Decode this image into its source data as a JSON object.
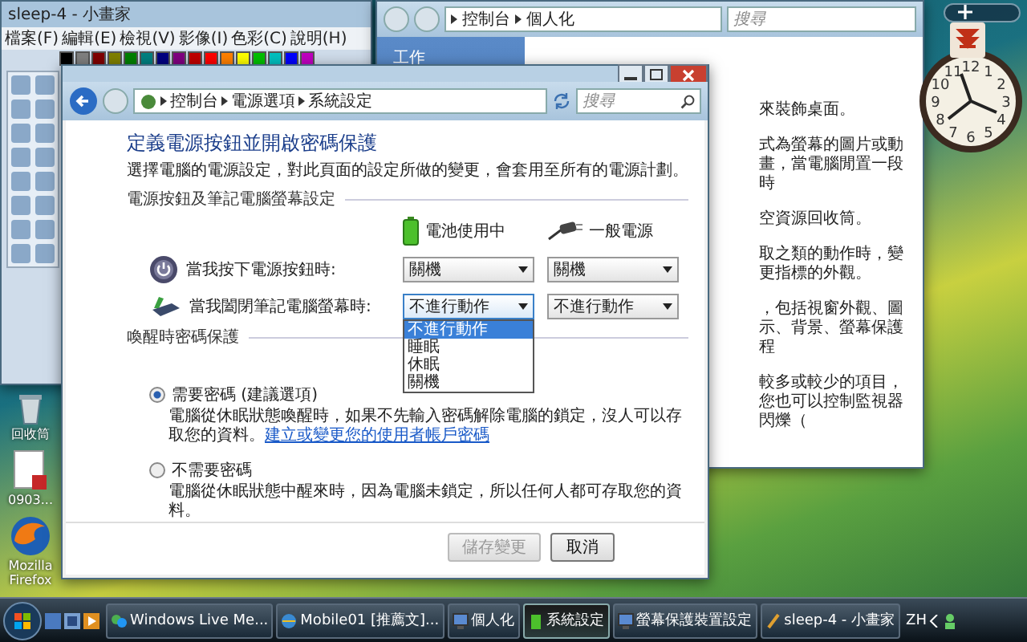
{
  "paint_window": {
    "title": "sleep-4 - 小畫家",
    "menus": [
      "檔案(F)",
      "編輯(E)",
      "檢視(V)",
      "影像(I)",
      "色彩(C)",
      "說明(H)"
    ]
  },
  "personalize_window": {
    "breadcrumb": [
      "控制台",
      "個人化"
    ],
    "search": {
      "placeholder": "搜尋"
    },
    "sidebar_title": "工作",
    "descriptions": [
      "來裝飾桌面。",
      "式為螢幕的圖片或動畫，當電腦閒置一段時",
      "空資源回收筒。",
      "取之類的動作時，變更指標的外觀。",
      "，包括視窗外觀、圖示、背景、螢幕保護程",
      "較多或較少的項目，您也可以控制監視器閃爍（"
    ]
  },
  "dialog": {
    "breadcrumb": [
      "控制台",
      "電源選項",
      "系統設定"
    ],
    "search": {
      "placeholder": "搜尋"
    },
    "title": "定義電源按鈕並開啟密碼保護",
    "description": "選擇電腦的電源設定，對此頁面的設定所做的變更，會套用至所有的電源計劃。",
    "button_section": {
      "heading": "電源按鈕及筆記電腦螢幕設定",
      "columns": [
        {
          "kind": "battery",
          "label": "電池使用中"
        },
        {
          "kind": "plug",
          "label": "一般電源"
        }
      ],
      "rows": [
        {
          "kind": "power",
          "label": "當我按下電源按鈕時:",
          "values": [
            "關機",
            "關機"
          ],
          "expanded": false
        },
        {
          "kind": "lid",
          "label": "當我闔閉筆記電腦螢幕時:",
          "values": [
            "不進行動作",
            "不進行動作"
          ],
          "expanded": true
        }
      ],
      "options": [
        {
          "label": "不進行動作",
          "selected": true
        },
        {
          "label": "睡眠",
          "selected": false
        },
        {
          "label": "休眠",
          "selected": false
        },
        {
          "label": "關機",
          "selected": false
        }
      ]
    },
    "password_section": {
      "heading": "喚醒時密碼保護",
      "options": [
        {
          "label": "需要密碼 (建議選項)",
          "selected": true,
          "description": "電腦從休眠狀態喚醒時，如果不先輸入密碼解除電腦的鎖定，沒人可以存取您的資料。",
          "link": "建立或變更您的使用者帳戶密碼"
        },
        {
          "label": "不需要密碼",
          "selected": false,
          "description": "電腦從休眠狀態中醒來時，因為電腦未鎖定，所以任何人都可存取您的資料。"
        }
      ]
    },
    "buttons": [
      {
        "label": "儲存變更",
        "disabled": true
      },
      {
        "label": "取消",
        "disabled": false
      }
    ]
  },
  "desktop_icons": [
    {
      "kind": "recycle",
      "label": "回收筒"
    },
    {
      "kind": "pdf",
      "label": "0903..."
    },
    {
      "kind": "browser",
      "label": "Mozilla Firefox"
    }
  ],
  "clock_numbers": [
    "11",
    "12",
    "1",
    "10",
    "2",
    "9",
    "3",
    "8",
    "4",
    "7",
    "6",
    "5"
  ],
  "taskbar": {
    "items": [
      {
        "kind": "messenger",
        "label": "Windows Live Me...",
        "selected": false
      },
      {
        "kind": "browser",
        "label": "Mobile01 [推薦文]...",
        "selected": false
      },
      {
        "kind": "monitor",
        "label": "個人化",
        "selected": false
      },
      {
        "kind": "power",
        "label": "系統設定",
        "selected": true
      },
      {
        "kind": "monitor",
        "label": "螢幕保護裝置設定",
        "selected": false
      },
      {
        "kind": "paint",
        "label": "sleep-4 - 小畫家",
        "selected": false
      }
    ],
    "language": "ZH"
  }
}
